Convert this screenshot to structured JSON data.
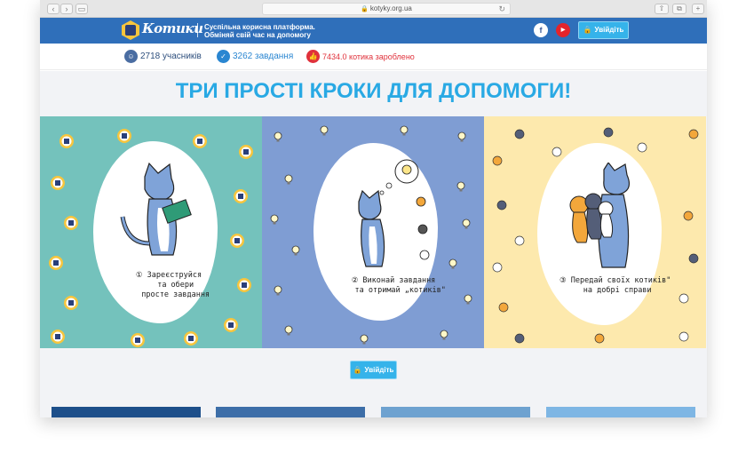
{
  "browser": {
    "url": "kotyky.org.ua"
  },
  "header": {
    "logo_text": "Котики",
    "tagline_line1": "Суспільна корисна платформа.",
    "tagline_line2": "Обміняй свій час на допомогу",
    "login_label": "Увійдіть",
    "facebook_icon": "f",
    "youtube_icon": "▶"
  },
  "stats": {
    "members": "2718 учасників",
    "tasks": "3262 завдання",
    "cats_earned": "7434.0 котика зароблено"
  },
  "main": {
    "title": "ТРИ ПРОСТІ КРОКИ ДЛЯ ДОПОМОГИ!",
    "steps": [
      {
        "caption": "① Зареєструйся\n   та обери\n   просте завдання"
      },
      {
        "caption": "② Виконай завдання\n   та отримай „котиків\""
      },
      {
        "caption": "③ Передай своїх котиків\"\n   на добрі справи"
      }
    ],
    "cta_label": "Увійдіть"
  },
  "colors": {
    "header_blue": "#2f6fba",
    "accent_blue": "#29a9e4",
    "panel1": "#74c2bc",
    "panel2": "#7f9dd3",
    "panel3": "#fde9ad"
  }
}
